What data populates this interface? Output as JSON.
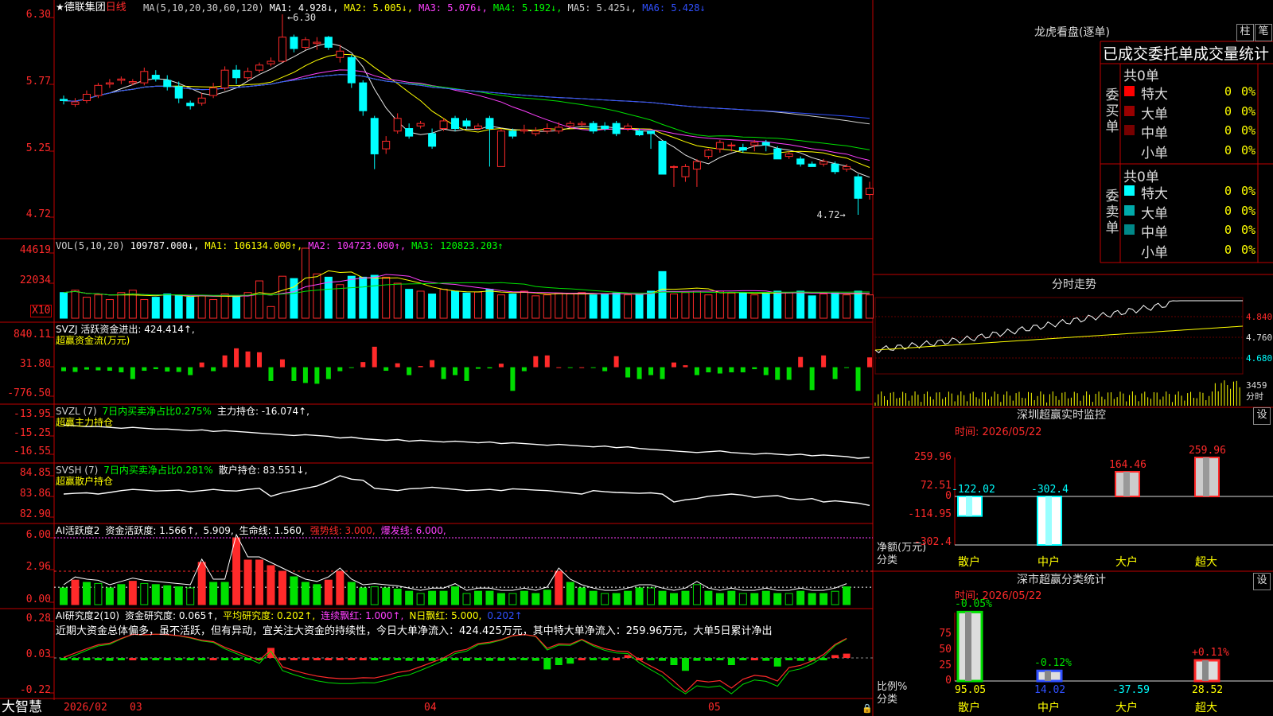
{
  "stock": {
    "star": "★",
    "name": "德联集团",
    "period": "日线"
  },
  "colors": {
    "up": "#ff2a2a",
    "down": "#00ffff",
    "green": "#00e000",
    "grid": "#c00000",
    "yellow": "#ffff00",
    "magenta": "#ff40ff",
    "white": "#e8e8e8",
    "blue": "#3050ff"
  },
  "main_panel": {
    "ma_labels": [
      {
        "text": "MA(5,10,20,30,60,120)",
        "color": "#d0d0d0"
      },
      {
        "text": "MA1: 4.928↓,",
        "color": "#ffffff"
      },
      {
        "text": "MA2: 5.005↓,",
        "color": "#ffff00"
      },
      {
        "text": "MA3: 5.076↓,",
        "color": "#ff40ff"
      },
      {
        "text": "MA4: 5.192↓,",
        "color": "#00ff00"
      },
      {
        "text": "MA5: 5.425↓,",
        "color": "#d0d0d0"
      },
      {
        "text": "MA6: 5.428↓",
        "color": "#3050ff"
      }
    ],
    "axis": [
      "6.30",
      "5.77",
      "5.25",
      "4.72"
    ],
    "high_label": "6.30",
    "low_label": "4.72"
  },
  "vol_panel": {
    "labels": [
      {
        "text": "VOL(5,10,20)",
        "color": "#d0d0d0"
      },
      {
        "text": "109787.000↓,",
        "color": "#ffffff"
      },
      {
        "text": "MA1: 106134.000↑,",
        "color": "#ffff00"
      },
      {
        "text": "MA2: 104723.000↑,",
        "color": "#ff40ff"
      },
      {
        "text": "MA3: 120823.203↑",
        "color": "#00ff00"
      }
    ],
    "axis": [
      "44619",
      "22034"
    ],
    "unit": "X10"
  },
  "svzj_panel": {
    "labels": [
      {
        "text": "SVZJ  活跃资金进出: 424.414↑,",
        "color": "#ffffff"
      }
    ],
    "sub": "超赢资金流(万元)",
    "axis": [
      "840.11",
      "31.80",
      "-776.50"
    ]
  },
  "svzl_panel": {
    "labels": [
      {
        "text": "SVZL (7)",
        "color": "#d0d0d0"
      },
      {
        "text": "7日内买卖净占比0.275%",
        "color": "#00ff00"
      },
      {
        "text": "主力持仓: -16.074↑,",
        "color": "#ffffff"
      }
    ],
    "sub": "超赢主力持仓",
    "axis": [
      "-13.95",
      "-15.25",
      "-16.55"
    ]
  },
  "svsh_panel": {
    "labels": [
      {
        "text": "SVSH (7)",
        "color": "#d0d0d0"
      },
      {
        "text": "7日内买卖净占比0.281%",
        "color": "#00ff00"
      },
      {
        "text": "散户持仓: 83.551↓,",
        "color": "#ffffff"
      }
    ],
    "sub": "超赢散户持仓",
    "axis": [
      "84.85",
      "83.86",
      "82.90"
    ]
  },
  "ai_active_panel": {
    "labels": [
      {
        "text": "AI活跃度2",
        "color": "#ffffff"
      },
      {
        "text": "资金活跃度: 1.566↑,",
        "color": "#ffffff"
      },
      {
        "text": "5.909,",
        "color": "#ffffff"
      },
      {
        "text": "生命线: 1.560,",
        "color": "#ffffff"
      },
      {
        "text": "强势线: 3.000,",
        "color": "#ff2a2a"
      },
      {
        "text": "爆发线: 6.000,",
        "color": "#ff40ff"
      }
    ],
    "axis": [
      "6.00",
      "2.96",
      "0.00"
    ]
  },
  "ai_research_panel": {
    "labels": [
      {
        "text": "AI研究度2(10)",
        "color": "#ffffff"
      },
      {
        "text": "资金研究度: 0.065↑,",
        "color": "#ffffff"
      },
      {
        "text": "平均研究度: 0.202↑,",
        "color": "#ffff00"
      },
      {
        "text": "连续飘红: 1.000↑,",
        "color": "#ff40ff"
      },
      {
        "text": "N日飘红: 5.000,",
        "color": "#ffff00"
      },
      {
        "text": "0.202↑",
        "color": "#3050ff"
      }
    ],
    "comment": "近期大资金总体偏多，虽不活跃，但有异动，宜关注大资金的持续性，今日大单净流入：424.425万元，其中特大单净流入：259.96万元，大单5日累计净出",
    "axis": [
      "0.28",
      "0.03",
      "-0.22"
    ]
  },
  "bottom_bar": {
    "brand": "大智慧",
    "dates": [
      "2026/02",
      "03",
      "04",
      "05"
    ]
  },
  "right_panel": {
    "title": "龙虎看盘(逐单)",
    "btn_zhu": "柱",
    "btn_bi": "笔",
    "header": "已成交委托单成交量统计",
    "buy": {
      "side_label": "委买单",
      "total": "共0单",
      "rows": [
        {
          "label": "特大",
          "value": "0",
          "pct": "0%",
          "color": "#ff0000"
        },
        {
          "label": "大单",
          "value": "0",
          "pct": "0%",
          "color": "#990000"
        },
        {
          "label": "中单",
          "value": "0",
          "pct": "0%",
          "color": "#770000"
        },
        {
          "label": "小单",
          "value": "0",
          "pct": "0%",
          "color": "#000000"
        }
      ]
    },
    "sell": {
      "side_label": "委卖单",
      "total": "共0单",
      "rows": [
        {
          "label": "特大",
          "value": "0",
          "pct": "0%",
          "color": "#00ffff"
        },
        {
          "label": "大单",
          "value": "0",
          "pct": "0%",
          "color": "#00aaaa"
        },
        {
          "label": "中单",
          "value": "0",
          "pct": "0%",
          "color": "#008888"
        },
        {
          "label": "小单",
          "value": "0",
          "pct": "0%",
          "color": "#000000"
        }
      ]
    },
    "minute": {
      "title": "分时走势",
      "axis": [
        "4.840",
        "4.760",
        "4.680"
      ],
      "vol_label": "3459",
      "vol_sub": "分时"
    },
    "monitor": {
      "title": "深圳超赢实时监控",
      "settings": "设",
      "time": "时间: 2026/05/22",
      "axis": [
        "259.96",
        "72.51",
        "0",
        "-114.95",
        "-302.4"
      ],
      "ylabel": "净额(万元)",
      "xlabel": "分类",
      "categories": [
        "散户",
        "中户",
        "大户",
        "超大"
      ],
      "values": [
        -122.02,
        -302.4,
        164.46,
        259.96
      ],
      "value_labels": [
        "-122.02",
        "-302.4",
        "164.46",
        "259.96"
      ]
    },
    "stats": {
      "title": "深市超赢分类统计",
      "settings": "设",
      "time": "时间: 2026/05/22",
      "axis": [
        "75",
        "50",
        "25",
        "0"
      ],
      "ylabel": "比例%",
      "xlabel": "分类",
      "categories": [
        "散户",
        "中户",
        "大户",
        "超大"
      ],
      "top_labels": [
        "-0.05%",
        "-0.12%",
        "",
        "+0.11%"
      ],
      "bottom_labels": [
        "95.05",
        "14.02",
        "-37.59",
        "28.52"
      ],
      "bottom_colors": [
        "#ffff00",
        "#3050ff",
        "#00ffff",
        "#ffff00"
      ],
      "values": [
        95.05,
        14.02,
        -37.59,
        28.52
      ]
    }
  },
  "chart_data": {
    "type": "candlestick",
    "candles": [
      [
        5.63,
        5.62,
        5.66,
        5.59
      ],
      [
        5.59,
        5.61,
        5.64,
        5.57
      ],
      [
        5.62,
        5.67,
        5.7,
        5.6
      ],
      [
        5.66,
        5.74,
        5.76,
        5.64
      ],
      [
        5.75,
        5.76,
        5.79,
        5.72
      ],
      [
        5.78,
        5.79,
        5.81,
        5.75
      ],
      [
        5.76,
        5.77,
        5.79,
        5.74
      ],
      [
        5.76,
        5.85,
        5.88,
        5.74
      ],
      [
        5.82,
        5.79,
        5.86,
        5.77
      ],
      [
        5.78,
        5.73,
        5.82,
        5.7
      ],
      [
        5.73,
        5.64,
        5.77,
        5.6
      ],
      [
        5.6,
        5.58,
        5.62,
        5.55
      ],
      [
        5.6,
        5.64,
        5.68,
        5.58
      ],
      [
        5.66,
        5.72,
        5.76,
        5.64
      ],
      [
        5.72,
        5.86,
        5.89,
        5.7
      ],
      [
        5.86,
        5.8,
        5.9,
        5.75
      ],
      [
        5.8,
        5.85,
        5.88,
        5.78
      ],
      [
        5.86,
        5.9,
        5.92,
        5.84
      ],
      [
        5.91,
        5.93,
        5.96,
        5.89
      ],
      [
        5.93,
        6.12,
        6.3,
        5.92
      ],
      [
        6.12,
        6.03,
        6.14,
        6.0
      ],
      [
        6.04,
        6.1,
        6.12,
        6.02
      ],
      [
        6.07,
        6.08,
        6.12,
        6.02
      ],
      [
        6.12,
        6.04,
        6.13,
        6.02
      ],
      [
        5.96,
        6.01,
        6.06,
        5.92
      ],
      [
        5.96,
        5.76,
        5.98,
        5.72
      ],
      [
        5.76,
        5.54,
        5.78,
        5.5
      ],
      [
        5.48,
        5.2,
        5.5,
        5.08
      ],
      [
        5.24,
        5.3,
        5.34,
        5.2
      ],
      [
        5.38,
        5.48,
        5.52,
        5.36
      ],
      [
        5.4,
        5.34,
        5.44,
        5.32
      ],
      [
        5.42,
        5.44,
        5.46,
        5.4
      ],
      [
        5.36,
        5.26,
        5.4,
        5.24
      ],
      [
        5.4,
        5.46,
        5.48,
        5.38
      ],
      [
        5.48,
        5.4,
        5.5,
        5.38
      ],
      [
        5.46,
        5.42,
        5.48,
        5.4
      ],
      [
        5.4,
        5.42,
        5.44,
        5.39
      ],
      [
        5.48,
        5.4,
        5.5,
        5.1
      ],
      [
        5.1,
        5.38,
        5.4,
        5.1
      ],
      [
        5.38,
        5.34,
        5.4,
        5.32
      ],
      [
        5.38,
        5.39,
        5.43,
        5.36
      ],
      [
        5.36,
        5.38,
        5.41,
        5.34
      ],
      [
        5.38,
        5.4,
        5.44,
        5.36
      ],
      [
        5.38,
        5.41,
        5.45,
        5.36
      ],
      [
        5.42,
        5.44,
        5.46,
        5.4
      ],
      [
        5.43,
        5.44,
        5.46,
        5.42
      ],
      [
        5.44,
        5.38,
        5.46,
        5.36
      ],
      [
        5.42,
        5.4,
        5.45,
        5.38
      ],
      [
        5.44,
        5.36,
        5.46,
        5.34
      ],
      [
        5.4,
        5.42,
        5.44,
        5.38
      ],
      [
        5.38,
        5.35,
        5.4,
        5.34
      ],
      [
        5.38,
        5.36,
        5.38,
        5.24
      ],
      [
        5.3,
        5.04,
        5.3,
        5.04
      ],
      [
        5.1,
        5.1,
        5.11,
        4.94
      ],
      [
        5.02,
        5.1,
        5.12,
        4.98
      ],
      [
        5.08,
        5.14,
        5.16,
        4.94
      ],
      [
        5.18,
        5.23,
        5.24,
        5.16
      ],
      [
        5.24,
        5.29,
        5.31,
        5.21
      ],
      [
        5.27,
        5.27,
        5.29,
        5.22
      ],
      [
        5.25,
        5.23,
        5.28,
        5.21
      ],
      [
        5.27,
        5.29,
        5.31,
        5.22
      ],
      [
        5.29,
        5.27,
        5.31,
        5.22
      ],
      [
        5.24,
        5.16,
        5.26,
        5.16
      ],
      [
        5.18,
        5.2,
        5.22,
        5.16
      ],
      [
        5.16,
        5.12,
        5.18,
        5.1
      ],
      [
        5.12,
        5.1,
        5.14,
        5.1
      ],
      [
        5.12,
        5.14,
        5.16,
        5.1
      ],
      [
        5.12,
        5.06,
        5.14,
        5.04
      ],
      [
        5.08,
        5.1,
        5.12,
        5.06
      ],
      [
        5.02,
        4.85,
        5.04,
        4.72
      ],
      [
        4.88,
        4.93,
        4.98,
        4.84
      ]
    ],
    "volume": [
      55,
      60,
      45,
      50,
      40,
      55,
      60,
      40,
      45,
      52,
      50,
      45,
      48,
      40,
      52,
      48,
      55,
      80,
      25,
      90,
      85,
      150,
      95,
      88,
      72,
      90,
      88,
      92,
      88,
      75,
      62,
      58,
      52,
      62,
      58,
      54,
      56,
      62,
      50,
      52,
      58,
      48,
      50,
      54,
      52,
      55,
      50,
      52,
      54,
      50,
      50,
      58,
      100,
      52,
      55,
      58,
      50,
      58,
      54,
      55,
      50,
      52,
      58,
      55,
      58,
      48,
      52,
      54,
      50,
      58,
      50
    ],
    "svzj": [
      -100,
      -120,
      -60,
      -80,
      -90,
      -130,
      -300,
      -90,
      -50,
      -110,
      -120,
      -200,
      120,
      -100,
      300,
      480,
      400,
      380,
      -350,
      200,
      -350,
      -400,
      -420,
      -300,
      -100,
      -20,
      130,
      520,
      -90,
      100,
      -200,
      30,
      180,
      -300,
      -200,
      -350,
      -40,
      -30,
      90,
      -600,
      -100,
      280,
      300,
      0,
      -20,
      0,
      -20,
      -100,
      280,
      -260,
      -300,
      -200,
      -300,
      120,
      50,
      -200,
      -130,
      -160,
      -130,
      -130,
      -50,
      -200,
      -320,
      -320,
      260,
      -580,
      300,
      -300,
      -20,
      -600,
      250
    ],
    "svzl": [
      -14.4,
      -14.45,
      -14.5,
      -14.5,
      -14.55,
      -14.6,
      -14.55,
      -14.6,
      -14.65,
      -14.65,
      -14.7,
      -14.75,
      -14.7,
      -14.8,
      -14.75,
      -14.8,
      -14.85,
      -14.9,
      -14.95,
      -15.0,
      -15.05,
      -15.0,
      -15.05,
      -15.1,
      -15.2,
      -15.15,
      -15.25,
      -15.3,
      -15.35,
      -15.3,
      -15.4,
      -15.35,
      -15.4,
      -15.45,
      -15.4,
      -15.45,
      -15.5,
      -15.45,
      -15.55,
      -15.5,
      -15.55,
      -15.6,
      -15.65,
      -15.6,
      -15.65,
      -15.7,
      -15.75,
      -15.7,
      -15.8,
      -15.75,
      -15.85,
      -15.9,
      -15.95,
      -16.0,
      -16.05,
      -16.1,
      -16.05,
      -16.0,
      -16.1,
      -16.15,
      -16.2,
      -16.15,
      -16.2,
      -16.25,
      -16.2,
      -16.3,
      -16.25,
      -16.3,
      -16.35,
      -16.45,
      -16.4
    ],
    "svsh": [
      84.05,
      84.08,
      84.1,
      84.05,
      84.12,
      84.2,
      84.25,
      84.22,
      84.18,
      84.2,
      84.22,
      84.15,
      84.2,
      84.25,
      84.2,
      84.18,
      84.25,
      84.3,
      83.95,
      84.1,
      84.2,
      84.3,
      84.4,
      84.6,
      84.85,
      84.7,
      84.65,
      84.3,
      84.25,
      84.2,
      84.28,
      84.3,
      84.35,
      84.3,
      84.25,
      84.2,
      84.22,
      84.25,
      84.2,
      84.28,
      84.25,
      84.22,
      84.2,
      84.15,
      84.1,
      84.05,
      84.2,
      84.15,
      84.12,
      84.1,
      84.08,
      84.1,
      84.05,
      83.7,
      83.8,
      83.85,
      83.95,
      84.0,
      84.05,
      84.0,
      83.9,
      83.95,
      83.98,
      83.85,
      83.8,
      83.85,
      83.7,
      83.75,
      83.7,
      83.65,
      83.55
    ],
    "ai_active": [
      1.5,
      2.2,
      2.0,
      1.9,
      1.5,
      1.8,
      2.1,
      1.9,
      1.8,
      1.7,
      1.6,
      1.5,
      3.8,
      2.0,
      2.0,
      6.0,
      4.0,
      4.0,
      3.5,
      3.0,
      2.5,
      2.0,
      1.8,
      2.2,
      3.0,
      2.0,
      1.5,
      1.6,
      1.5,
      1.4,
      1.2,
      1.0,
      1.2,
      1.2,
      1.6,
      1.0,
      1.2,
      1.2,
      1.0,
      1.0,
      1.2,
      1.0,
      1.3,
      3.0,
      2.0,
      1.5,
      1.2,
      1.0,
      1.0,
      1.2,
      1.5,
      1.5,
      1.2,
      1.0,
      1.2,
      1.8,
      1.2,
      1.0,
      1.2,
      1.0,
      1.0,
      1.2,
      1.0,
      1.0,
      1.2,
      1.0,
      1.0,
      1.2,
      1.6
    ],
    "ai_research": [
      0.02,
      0.02,
      0.02,
      0.02,
      0.01,
      0.02,
      0.03,
      0.02,
      0.02,
      0.02,
      0.02,
      0.02,
      0.02,
      0.03,
      0.02,
      0.02,
      0.02,
      0.02,
      0.1,
      0.03,
      0.03,
      0.03,
      0.03,
      0.03,
      0.03,
      0.03,
      0.03,
      0.02,
      0.02,
      0.02,
      0.01,
      0.01,
      0.01,
      0.01,
      0.02,
      0.01,
      0.02,
      0.01,
      0.01,
      0.02,
      0.02,
      0.01,
      -0.05,
      -0.02,
      -0.01,
      0.03,
      0.02,
      0.02,
      0.03,
      0.05,
      0.03,
      0.02,
      0.01,
      -0.02,
      -0.06,
      0.01,
      0.01,
      0.02,
      -0.02,
      0.02,
      0.03,
      0.01,
      -0.03,
      0.02,
      0.01,
      0.01,
      0.02,
      0.05,
      0.06
    ]
  }
}
